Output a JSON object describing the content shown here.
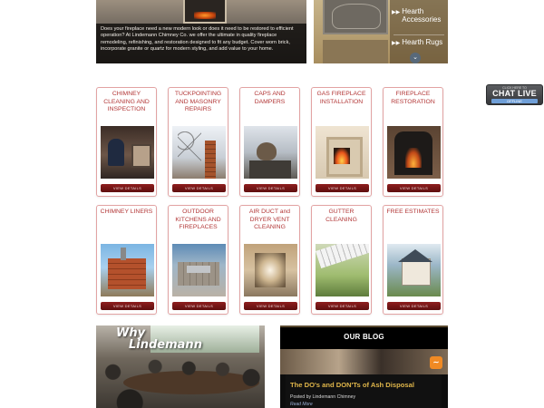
{
  "hero": {
    "caption": "Does your fireplace need a new modern look or does it need to be restored to efficient operation? At Lindemann Chimney Co. we offer the ultimate in quality fireplace remodeling, refinishing, and restoration designed to fit any budget. Cover worn brick, incorporate granite or quartz for modern styling, and add value to your home."
  },
  "side_nav": {
    "items": [
      {
        "label": "Hearth Accessories"
      },
      {
        "label": "Hearth Rugs"
      }
    ]
  },
  "chat": {
    "small": "CLICK HERE TO",
    "big": "CHAT LIVE",
    "status": "OFFLINE"
  },
  "services": [
    {
      "title": "CHIMNEY CLEANING AND INSPECTION",
      "button": "VIEW DETAILS"
    },
    {
      "title": "TUCKPOINTING AND MASONRY REPAIRS",
      "button": "VIEW DETAILS"
    },
    {
      "title": "CAPS AND DAMPERS",
      "button": "VIEW DETAILS"
    },
    {
      "title": "GAS FIREPLACE INSTALLATION",
      "button": "VIEW DETAILS"
    },
    {
      "title": "FIREPLACE RESTORATION",
      "button": "VIEW DETAILS"
    },
    {
      "title": "CHIMNEY LINERS",
      "button": "VIEW DETAILS"
    },
    {
      "title": "OUTDOOR KITCHENS AND FIREPLACES",
      "button": "VIEW DETAILS"
    },
    {
      "title": "AIR DUCT and DRYER VENT CLEANING",
      "button": "VIEW DETAILS"
    },
    {
      "title": "GUTTER CLEANING",
      "button": "VIEW DETAILS"
    },
    {
      "title": "FREE ESTIMATES",
      "button": "VIEW DETAILS"
    }
  ],
  "why": {
    "line1": "Why",
    "line2": "Lindemann"
  },
  "blog": {
    "heading": "OUR BLOG",
    "post_title": "The DO's and DON'Ts of Ash Disposal",
    "meta": "Posted by Lindemann Chimney",
    "read_more": "Read More"
  }
}
